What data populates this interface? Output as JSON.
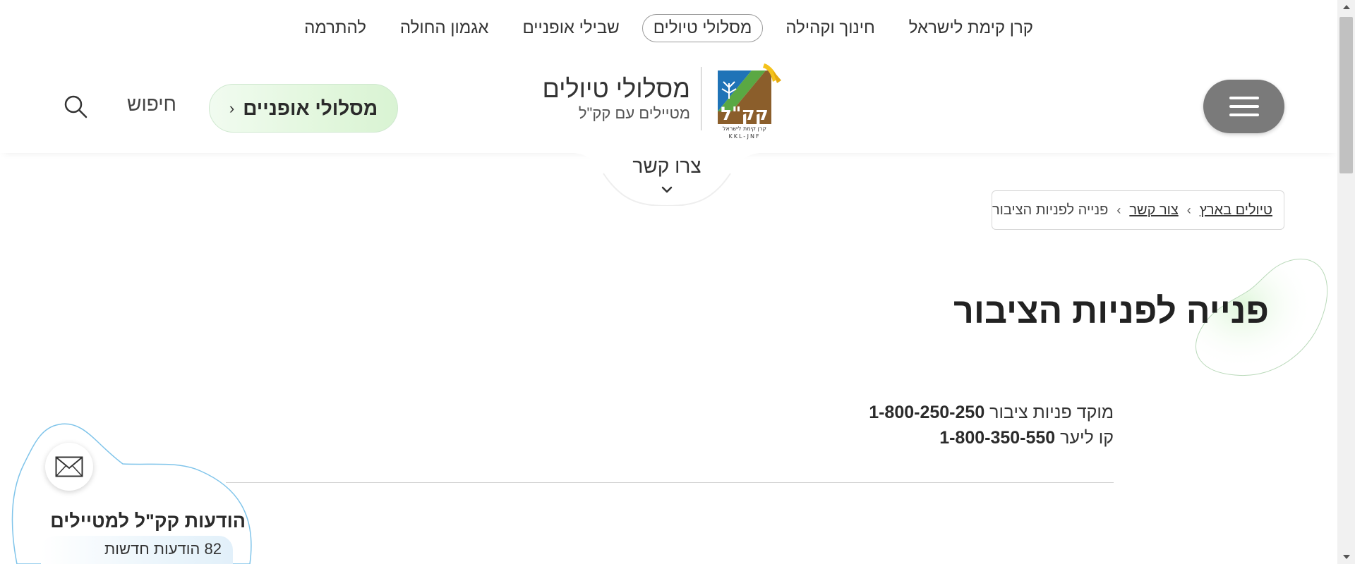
{
  "top_nav": {
    "items": [
      {
        "label": "קרן קימת לישראל",
        "active": false
      },
      {
        "label": "חינוך וקהילה",
        "active": false
      },
      {
        "label": "מסלולי טיולים",
        "active": true
      },
      {
        "label": "שבילי אופניים",
        "active": false
      },
      {
        "label": "אגמון החולה",
        "active": false
      },
      {
        "label": "להתרמה",
        "active": false
      }
    ]
  },
  "header": {
    "site_title": "מסלולי טיולים",
    "site_subtitle": "מטיילים עם קק\"ל",
    "logo": {
      "text_main": "קק\"ל",
      "text_small": "קרן קימת לישראל",
      "text_latin": "KKL-JNF"
    },
    "bikes_button": "מסלולי אופניים",
    "search_label": "חיפוש"
  },
  "contact_tab": {
    "label": "צרו קשר"
  },
  "breadcrumb": {
    "items": [
      {
        "label": "טיולים בארץ",
        "link": true
      },
      {
        "label": "צור קשר",
        "link": true
      },
      {
        "label": "פנייה לפניות הציבור",
        "link": false
      }
    ]
  },
  "main": {
    "title": "פנייה לפניות הציבור",
    "contact_lines": [
      {
        "label": "מוקד פניות ציבור",
        "number": "1-800-250-250"
      },
      {
        "label": "קו ליער",
        "number": "1-800-350-550"
      }
    ]
  },
  "messages_widget": {
    "title": "הודעות קק\"ל למטיילים",
    "count": "82",
    "count_label": "הודעות חדשות"
  },
  "colors": {
    "menu_button": "#7a7a7a",
    "bikes_button_bg": "#e2f7dd",
    "logo_blue": "#1f73b7",
    "logo_green": "#5aa843",
    "logo_brown": "#8b5e2b",
    "logo_yellow": "#f4c21b",
    "messages_blob": "#7fc4ea"
  },
  "icons": {
    "search": "search-icon",
    "menu": "hamburger-icon",
    "mail": "envelope-icon",
    "chevron": "chevron-left-icon"
  }
}
